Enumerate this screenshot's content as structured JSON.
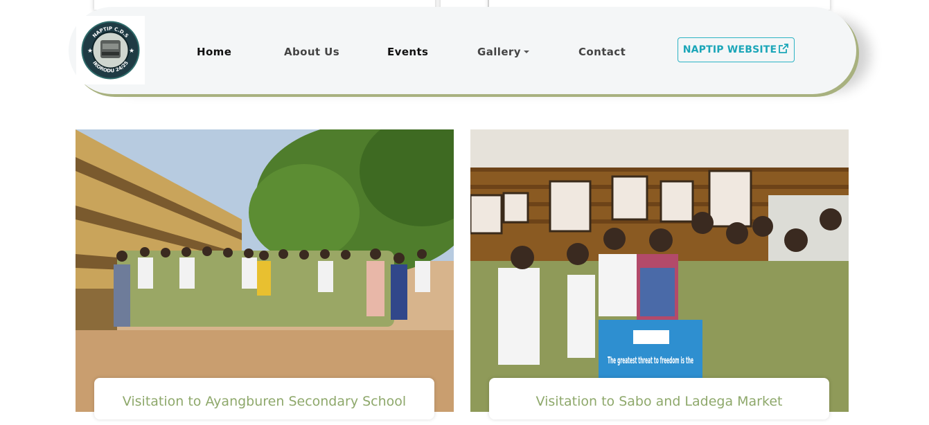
{
  "nav": {
    "logo_text_top": "NAPTIP C.D.S",
    "logo_text_bottom": "IKORODU 24/25",
    "links": [
      {
        "label": "Home"
      },
      {
        "label": "About Us"
      },
      {
        "label": "Events"
      },
      {
        "label": "Gallery"
      },
      {
        "label": "Contact"
      }
    ],
    "website_button": "NAPTIP WEBSITE"
  },
  "events": [
    {
      "title": "Visitation to Ayangburen Secondary School"
    },
    {
      "title": "Visitation to Sabo and Ladega Market",
      "banner_text": "The greatest threat to freedom is the"
    }
  ],
  "colors": {
    "accent": "#1ba6b8",
    "caption_text": "#8ea86b",
    "nav_shadow": "#a8b17f"
  }
}
